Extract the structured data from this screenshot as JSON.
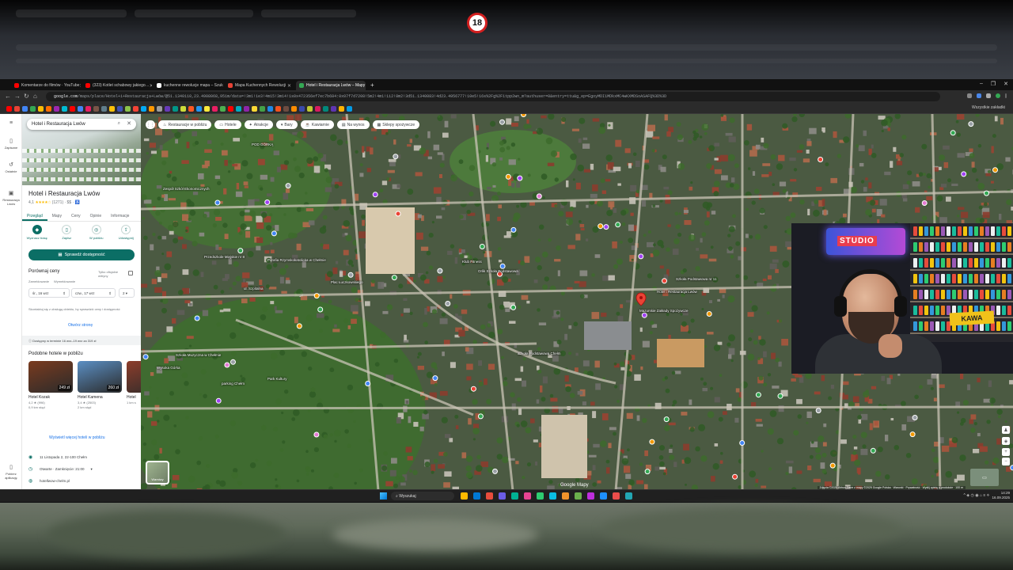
{
  "overlay": {
    "age_badge": "18"
  },
  "browser": {
    "tabs": [
      {
        "label": "Komentarze do filmów · YouTube",
        "color": "#ff0000",
        "active": false
      },
      {
        "label": "(323) Kotlet schabowy jakiego…",
        "color": "#ff0000",
        "active": false
      },
      {
        "label": "kuchenne rewolucje mapa – Szukaj",
        "color": "#ffffff",
        "active": false
      },
      {
        "label": "Mapa Kuchennych Rewolucji",
        "color": "#e94235",
        "active": false
      },
      {
        "label": "Hotel i Restauracja Lwów – Mapy",
        "color": "#34a853",
        "active": true
      }
    ],
    "url_prefix": "google.com",
    "url_rest": "/maps/place/Hotel+i+Restauracja+Lwów/@51.1340110,23.4908068,951m/data=!3m1!1e3!4m15!3m14!1s0x472356ef7ec7b684:0x07f7d7208!5m2!4m1!1i2!8m2!3d51.1340083!4d23.4956777!10e5!16s%2Fg%2F1tpp2wn_m?authuser=0&entry=ttu&g_ep=EgoyMDI1MDkxMC4wKXMDSoASAFQ%3D%3D",
    "bookmarks_all": "Wszystkie zakładki",
    "window_controls": [
      "–",
      "❐",
      "✕"
    ]
  },
  "rail": {
    "items": [
      {
        "icon": "menu-icon",
        "glyph": "≡",
        "label": ""
      },
      {
        "icon": "bookmark-icon",
        "glyph": "▯",
        "label": "Zapisane"
      },
      {
        "icon": "history-icon",
        "glyph": "↺",
        "label": "Ostatnie"
      },
      {
        "icon": "place-thumb-icon",
        "glyph": "▣",
        "label": "Restauracja Lwów"
      },
      {
        "icon": "phone-icon",
        "glyph": "▯",
        "label": "Pobierz aplikację"
      }
    ]
  },
  "place": {
    "search_value": "Hotel i Restauracja Lwów",
    "title": "Hotel i Restauracja Lwów",
    "rating": "4,1",
    "stars": "★★★★☆",
    "reviews": "(1271)",
    "price": "· $$ ·",
    "tabs": [
      "Przegląd",
      "Mapy",
      "Ceny",
      "Opinie",
      "Informacje"
    ],
    "active_tab": 0,
    "actions": [
      {
        "label": "Wyznacz trasę",
        "glyph": "◆",
        "filled": true
      },
      {
        "label": "Zapisz",
        "glyph": "▯",
        "filled": false
      },
      {
        "label": "W pobliżu",
        "glyph": "◎",
        "filled": false
      },
      {
        "label": "Udostępnij",
        "glyph": "⇪",
        "filled": false
      }
    ],
    "check_button": "Sprawdź dostępność",
    "compare": {
      "title": "Porównaj ceny",
      "only_official": "Tylko oficjalne witryny",
      "checkin_label": "Zameldowanie",
      "checkout_label": "Wymeldowanie",
      "checkin_value": "śr., 16 wrz",
      "checkout_value": "czw., 17 wrz",
      "guests": "2",
      "note": "Skontaktuj się z obsługą obiektu, by sprawdzić ceny i dostępność",
      "open_site": "Otwórz stronę"
    },
    "availability": "Dostępny w terminie 16 wrz–19 wrz za 319 zł",
    "similar": {
      "title": "Podobne hotele w pobliżu",
      "hotels": [
        {
          "name": "Hotel Kozak",
          "price": "249 zł",
          "rating": "4,2 ★ (996)",
          "distance": "0,9 km stąd",
          "tone": "#7a3b1f"
        },
        {
          "name": "Hotel Kamena",
          "price": "260 zł",
          "rating": "3,4 ★ (2503)",
          "distance": "2 km stąd",
          "tone": "#5b8fc4"
        },
        {
          "name": "Hotel",
          "price": "",
          "rating": "",
          "distance": "1 km s",
          "tone": "#8d3d2b"
        }
      ],
      "more_link": "Wyświetl więcej hoteli w pobliżu"
    },
    "info": {
      "address": "11 Listopada 2, 22-100 Chełm",
      "hours": "Otwarte · Zamknięcie: 21:00",
      "website": "hotellwow-chelm.pl"
    }
  },
  "map": {
    "chips": [
      {
        "icon": "restaurant-icon",
        "glyph": "♨",
        "label": "Restauracje w pobliżu"
      },
      {
        "icon": "hotel-icon",
        "glyph": "▭",
        "label": "Hotele"
      },
      {
        "icon": "attraction-icon",
        "glyph": "✦",
        "label": "Atrakcje"
      },
      {
        "icon": "bar-icon",
        "glyph": "▾",
        "label": "Bary"
      },
      {
        "icon": "coffee-icon",
        "glyph": "☕",
        "label": "Kawiarnie"
      },
      {
        "icon": "takeout-icon",
        "glyph": "▤",
        "label": "Na wynos"
      },
      {
        "icon": "grocery-icon",
        "glyph": "▦",
        "label": "Sklepy spożywcze"
      }
    ],
    "labels": [
      "POD GÓRKĄ",
      "Zespół Szkół Ekonomicznych",
      "Przedszkole Miejskie nr 8",
      "Parafia Rzymskokatolicka w Chełmie",
      "Klub Fitness",
      "Orlik Szkoła Podstawowa",
      "Hotel i Restauracja Lwów",
      "Szkoła Podstawowa nr 11",
      "Wysoka Górka",
      "Park Kultury",
      "parking Chełm",
      "Szkoła Podstawowa Chełm",
      "ul. Szpitalna",
      "Plac Łuczkowskiego",
      "Szkoła Muzyczna w Chełmie",
      "Mazurskie Zakłady Spożywcze"
    ],
    "layers_label": "Warstwy",
    "logo": "Google Mapy",
    "copyright": "Zdjęcia ©2025 Airbus,Dane z mapy ©2025 Google Polska · Warunki · Prywatność · Wyślij opinię o produkcie · 100 m"
  },
  "webcam": {
    "sign": "STUDIO",
    "mug_sign": "KAWA"
  },
  "taskbar": {
    "search": "Wyszukaj",
    "tray": "^  ◈  ◷  ◉  ⌂  ≡  ⟡",
    "time": "14:29",
    "date": "16.09.2025",
    "apps": [
      "#ffb900",
      "#0078d4",
      "#e74c3c",
      "#6c5ce7",
      "#00b294",
      "#e84393",
      "#2ecc71",
      "#0abde3",
      "#f0932b",
      "#6ab04c",
      "#be2edd",
      "#1e90ff",
      "#eb4d4b",
      "#22a6b3"
    ]
  }
}
